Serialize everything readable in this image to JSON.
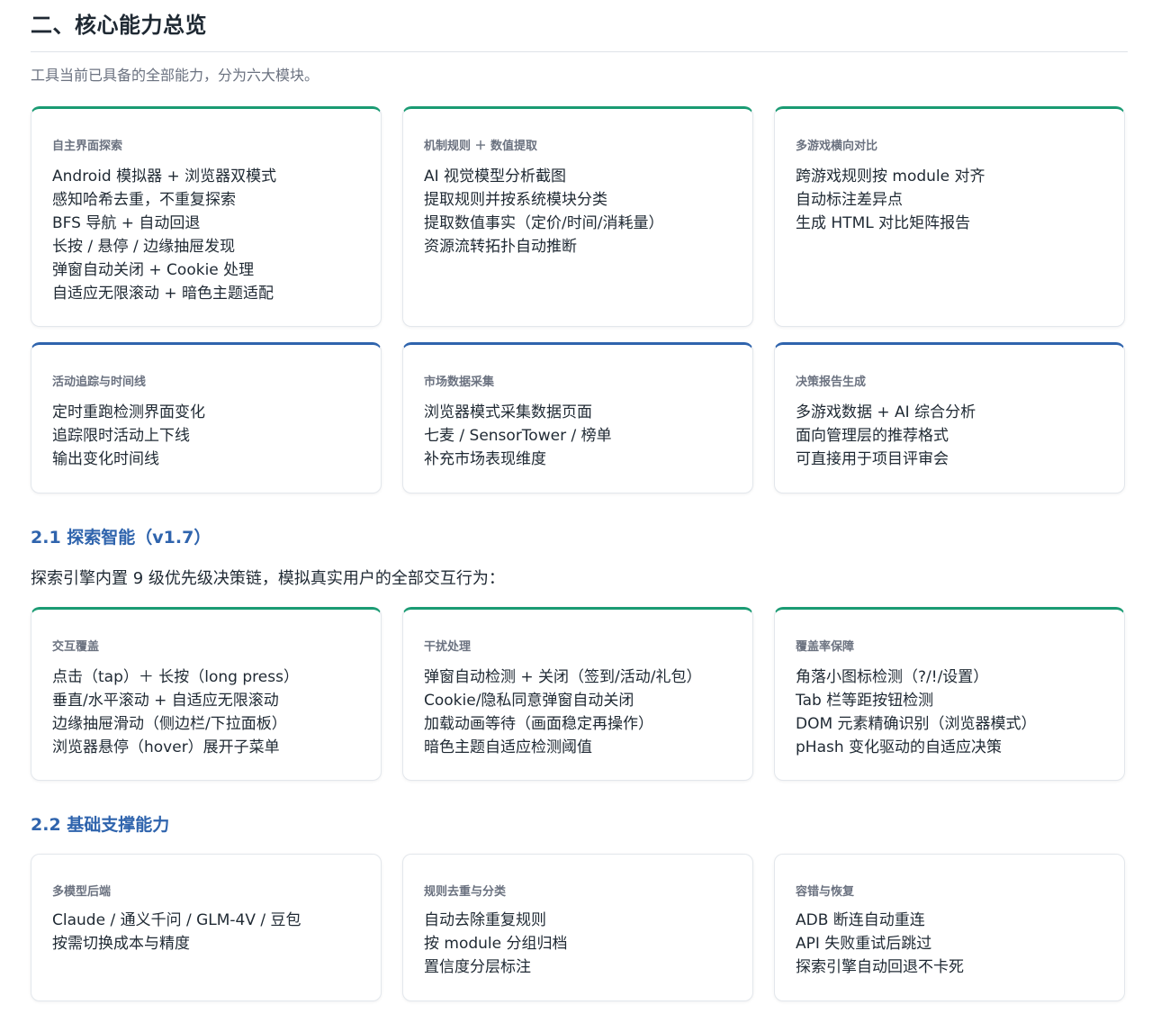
{
  "title": "二、核心能力总览",
  "intro": "工具当前已具备的全部能力，分为六大模块。",
  "modules": [
    {
      "title": "自主界面探索",
      "items": [
        "Android 模拟器 + 浏览器双模式",
        "感知哈希去重，不重复探索",
        "BFS 导航 + 自动回退",
        "长按 / 悬停 / 边缘抽屉发现",
        "弹窗自动关闭 + Cookie 处理",
        "自适应无限滚动 + 暗色主题适配"
      ]
    },
    {
      "title": "机制规则 ＋ 数值提取",
      "items": [
        "AI 视觉模型分析截图",
        "提取规则并按系统模块分类",
        "提取数值事实（定价/时间/消耗量）",
        "资源流转拓扑自动推断"
      ]
    },
    {
      "title": "多游戏横向对比",
      "items": [
        "跨游戏规则按 module 对齐",
        "自动标注差异点",
        "生成 HTML 对比矩阵报告"
      ]
    },
    {
      "title": "活动追踪与时间线",
      "items": [
        "定时重跑检测界面变化",
        "追踪限时活动上下线",
        "输出变化时间线"
      ]
    },
    {
      "title": "市场数据采集",
      "items": [
        "浏览器模式采集数据页面",
        "七麦 / SensorTower / 榜单",
        "补充市场表现维度"
      ]
    },
    {
      "title": "决策报告生成",
      "items": [
        "多游戏数据 + AI 综合分析",
        "面向管理层的推荐格式",
        "可直接用于项目评审会"
      ]
    }
  ],
  "section_21": {
    "heading": "2.1 探索智能（v1.7）",
    "desc": "探索引擎内置 9 级优先级决策链，模拟真实用户的全部交互行为：",
    "cards": [
      {
        "title": "交互覆盖",
        "items": [
          "点击（tap）＋ 长按（long press）",
          "垂直/水平滚动 + 自适应无限滚动",
          "边缘抽屉滑动（侧边栏/下拉面板）",
          "浏览器悬停（hover）展开子菜单"
        ]
      },
      {
        "title": "干扰处理",
        "items": [
          "弹窗自动检测 + 关闭（签到/活动/礼包）",
          "Cookie/隐私同意弹窗自动关闭",
          "加载动画等待（画面稳定再操作）",
          "暗色主题自适应检测阈值"
        ]
      },
      {
        "title": "覆盖率保障",
        "items": [
          "角落小图标检测（?/!/设置）",
          "Tab 栏等距按钮检测",
          "DOM 元素精确识别（浏览器模式）",
          "pHash 变化驱动的自适应决策"
        ]
      }
    ]
  },
  "section_22": {
    "heading": "2.2 基础支撑能力",
    "cards": [
      {
        "title": "多模型后端",
        "items": [
          "Claude / 通义千问 / GLM-4V / 豆包",
          "按需切换成本与精度"
        ]
      },
      {
        "title": "规则去重与分类",
        "items": [
          "自动去除重复规则",
          "按 module 分组归档",
          "置信度分层标注"
        ]
      },
      {
        "title": "容错与恢复",
        "items": [
          "ADB 断连自动重连",
          "API 失败重试后跳过",
          "探索引擎自动回退不卡死"
        ]
      }
    ]
  }
}
